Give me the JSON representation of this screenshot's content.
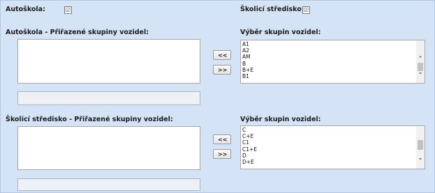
{
  "autoskola": {
    "label": "Autoškola:",
    "checked": true,
    "check_glyph": "☑"
  },
  "skolici": {
    "label": "Školicí středisko:",
    "checked": true,
    "check_glyph": "☑"
  },
  "section1": {
    "assigned_label": "Autoškola - Přiřazené skupiny vozidel:",
    "select_label": "Výběr skupin vozidel:",
    "btn_add": "<<",
    "btn_remove": ">>",
    "options": [
      "A1",
      "A2",
      "AM",
      "B",
      "B+E",
      "B1"
    ]
  },
  "section2": {
    "assigned_label": "Školicí středisko - Přiřazené skupiny vozidel:",
    "select_label": "Výběr skupin vozidel:",
    "btn_add": "<<",
    "btn_remove": ">>",
    "options": [
      "C",
      "C+E",
      "C1",
      "C1+E",
      "D",
      "D+E"
    ]
  },
  "icons": {
    "checkbox": "check-icon",
    "scroll_up": "chevron-up-icon",
    "scroll_down": "chevron-down-icon"
  },
  "colors": {
    "panel_bg": "#d5e3f6",
    "textfield_bg": "#eef1f5"
  }
}
